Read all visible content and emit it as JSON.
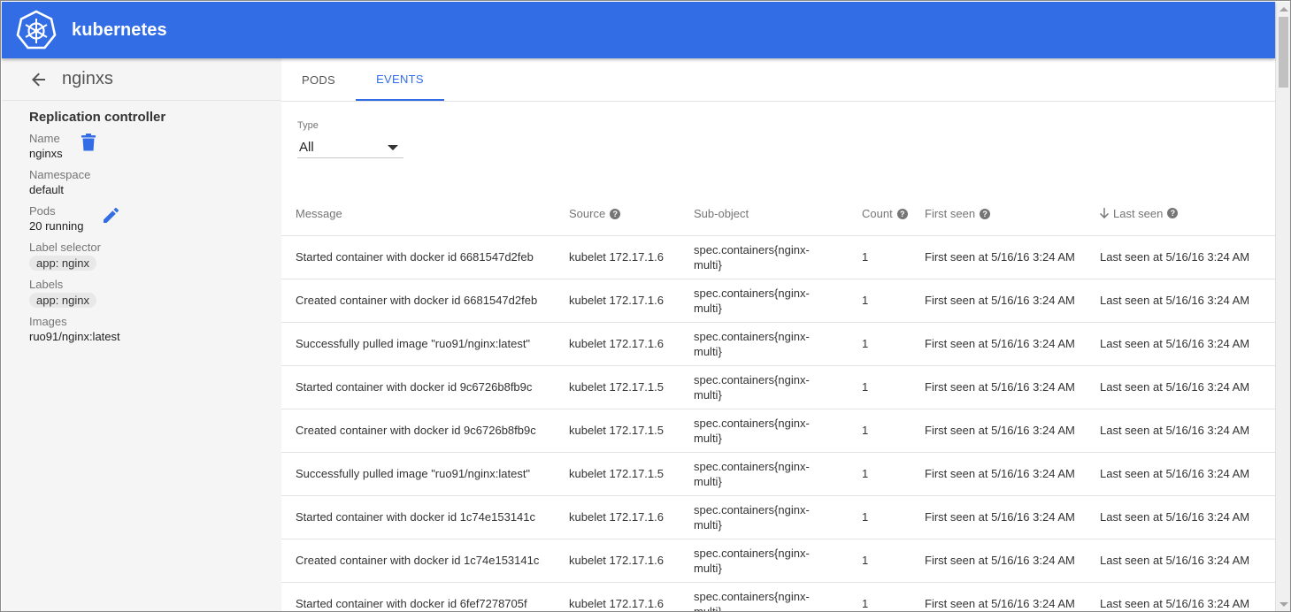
{
  "header": {
    "brand": "kubernetes"
  },
  "sidebar": {
    "title": "nginxs",
    "section_title": "Replication controller",
    "fields": {
      "name_label": "Name",
      "name_value": "nginxs",
      "namespace_label": "Namespace",
      "namespace_value": "default",
      "pods_label": "Pods",
      "pods_value": "20 running",
      "label_selector_label": "Label selector",
      "label_selector_chip": "app: nginx",
      "labels_label": "Labels",
      "labels_chip": "app: nginx",
      "images_label": "Images",
      "images_value": "ruo91/nginx:latest"
    }
  },
  "tabs": {
    "pods": "PODS",
    "events": "EVENTS",
    "active": "events"
  },
  "filter": {
    "label": "Type",
    "value": "All"
  },
  "table": {
    "headers": {
      "message": "Message",
      "source": "Source",
      "subobject": "Sub-object",
      "count": "Count",
      "first_seen": "First seen",
      "last_seen": "Last seen"
    },
    "sort": {
      "column": "last_seen",
      "direction": "descending"
    },
    "rows": [
      {
        "message": "Started container with docker id 6681547d2feb",
        "source": "kubelet 172.17.1.6",
        "subobject": "spec.containers{nginx-multi}",
        "count": "1",
        "first_seen": "First seen at 5/16/16 3:24 AM",
        "last_seen": "Last seen at 5/16/16 3:24 AM"
      },
      {
        "message": "Created container with docker id 6681547d2feb",
        "source": "kubelet 172.17.1.6",
        "subobject": "spec.containers{nginx-multi}",
        "count": "1",
        "first_seen": "First seen at 5/16/16 3:24 AM",
        "last_seen": "Last seen at 5/16/16 3:24 AM"
      },
      {
        "message": "Successfully pulled image \"ruo91/nginx:latest\"",
        "source": "kubelet 172.17.1.6",
        "subobject": "spec.containers{nginx-multi}",
        "count": "1",
        "first_seen": "First seen at 5/16/16 3:24 AM",
        "last_seen": "Last seen at 5/16/16 3:24 AM"
      },
      {
        "message": "Started container with docker id 9c6726b8fb9c",
        "source": "kubelet 172.17.1.5",
        "subobject": "spec.containers{nginx-multi}",
        "count": "1",
        "first_seen": "First seen at 5/16/16 3:24 AM",
        "last_seen": "Last seen at 5/16/16 3:24 AM"
      },
      {
        "message": "Created container with docker id 9c6726b8fb9c",
        "source": "kubelet 172.17.1.5",
        "subobject": "spec.containers{nginx-multi}",
        "count": "1",
        "first_seen": "First seen at 5/16/16 3:24 AM",
        "last_seen": "Last seen at 5/16/16 3:24 AM"
      },
      {
        "message": "Successfully pulled image \"ruo91/nginx:latest\"",
        "source": "kubelet 172.17.1.5",
        "subobject": "spec.containers{nginx-multi}",
        "count": "1",
        "first_seen": "First seen at 5/16/16 3:24 AM",
        "last_seen": "Last seen at 5/16/16 3:24 AM"
      },
      {
        "message": "Started container with docker id 1c74e153141c",
        "source": "kubelet 172.17.1.6",
        "subobject": "spec.containers{nginx-multi}",
        "count": "1",
        "first_seen": "First seen at 5/16/16 3:24 AM",
        "last_seen": "Last seen at 5/16/16 3:24 AM"
      },
      {
        "message": "Created container with docker id 1c74e153141c",
        "source": "kubelet 172.17.1.6",
        "subobject": "spec.containers{nginx-multi}",
        "count": "1",
        "first_seen": "First seen at 5/16/16 3:24 AM",
        "last_seen": "Last seen at 5/16/16 3:24 AM"
      },
      {
        "message": "Started container with docker id 6fef7278705f",
        "source": "kubelet 172.17.1.6",
        "subobject": "spec.containers{nginx-multi}",
        "count": "1",
        "first_seen": "First seen at 5/16/16 3:24 AM",
        "last_seen": "Last seen at 5/16/16 3:24 AM"
      }
    ]
  },
  "icons": {
    "logo": "kubernetes-helm-wheel-icon",
    "back": "arrow-left-icon",
    "delete": "trash-icon",
    "edit": "pencil-icon",
    "help": "question-circle-icon",
    "sort": "arrow-down-icon",
    "dropdown": "caret-down-icon"
  },
  "colors": {
    "brand": "#326de6",
    "accent": "#326de6",
    "sidebar_bg": "#f5f5f5"
  }
}
